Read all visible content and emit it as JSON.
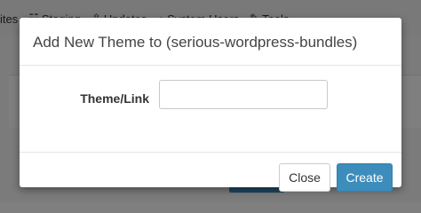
{
  "background": {
    "nav_items": [
      {
        "label": "ites",
        "icon": ""
      },
      {
        "label": "Staging",
        "icon": "staging-icon"
      },
      {
        "label": "Updates",
        "icon": "updates-icon"
      },
      {
        "label": "System Users",
        "icon": "user-icon"
      },
      {
        "label": "Tools",
        "icon": "wrench-icon"
      }
    ]
  },
  "modal": {
    "title": "Add New Theme to (serious-wordpress-bundles)",
    "field_label": "Theme/Link",
    "field_value": "",
    "field_placeholder": "",
    "close_label": "Close",
    "create_label": "Create",
    "accent_color": "#3c8dbc"
  }
}
